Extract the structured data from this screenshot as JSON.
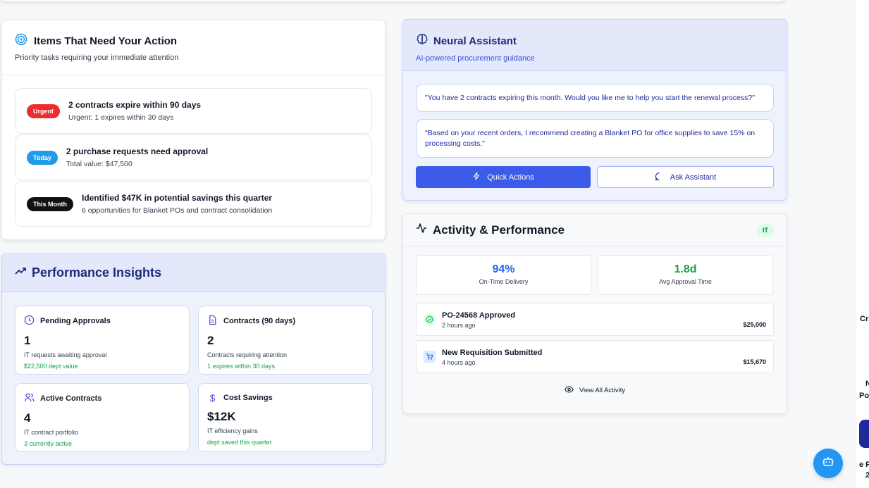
{
  "actions": {
    "title": "Items That Need Your Action",
    "subtitle": "Priority tasks requiring your immediate attention",
    "items": [
      {
        "badge": "Urgent",
        "badge_color": "#ef2b2d",
        "title": "2 contracts expire within 90 days",
        "subtitle": "Urgent: 1 expires within 30 days"
      },
      {
        "badge": "Today",
        "badge_color": "#1e9be9",
        "title": "2 purchase requests need approval",
        "subtitle": "Total value: $47,500"
      },
      {
        "badge": "This Month",
        "badge_color": "#111111",
        "title": "Identified $47K in potential savings this quarter",
        "subtitle": "6 opportunities for Blanket POs and contract consolidation"
      }
    ]
  },
  "insights": {
    "title": "Performance Insights",
    "tiles": [
      {
        "label": "Pending Approvals",
        "icon": "clock-icon",
        "value": "1",
        "desc": "IT requests awaiting approval",
        "note": "$22,500 dept value"
      },
      {
        "label": "Contracts (90 days)",
        "icon": "document-icon",
        "value": "2",
        "desc": "Contracts requiring attention",
        "note": "1 expires within 30 days"
      },
      {
        "label": "Active Contracts",
        "icon": "users-icon",
        "value": "4",
        "desc": "IT contract portfolio",
        "note": "3 currently active"
      },
      {
        "label": "Cost Savings",
        "icon": "dollar-icon",
        "value": "$12K",
        "desc": "IT efficiency gains",
        "note": "dept saved this quarter"
      }
    ]
  },
  "assistant": {
    "title": "Neural Assistant",
    "subtitle": "AI-powered procurement guidance",
    "messages": [
      "\"You have 2 contracts expiring this month. Would you like me to help you start the renewal process?\"",
      "\"Based on your recent orders, I recommend creating a Blanket PO for office supplies to save 15% on processing costs.\""
    ],
    "quick_actions_label": "Quick Actions",
    "ask_label": "Ask Assistant"
  },
  "activity": {
    "title": "Activity & Performance",
    "dept_badge": "IT",
    "metrics": [
      {
        "value": "94%",
        "label": "On-Time Delivery",
        "color": "#2563eb"
      },
      {
        "value": "1.8d",
        "label": "Avg Approval Time",
        "color": "#16a34a"
      }
    ],
    "rows": [
      {
        "title": "PO-24568 Approved",
        "time": "2 hours ago",
        "amount": "$25,000",
        "icon": "check-circle-icon"
      },
      {
        "title": "New Requisition Submitted",
        "time": "4 hours ago",
        "amount": "$15,670",
        "icon": "cart-icon"
      }
    ],
    "view_all": "View All Activity"
  },
  "edge_text": [
    "Cr",
    "N",
    "Pov",
    "e P",
    "2"
  ]
}
